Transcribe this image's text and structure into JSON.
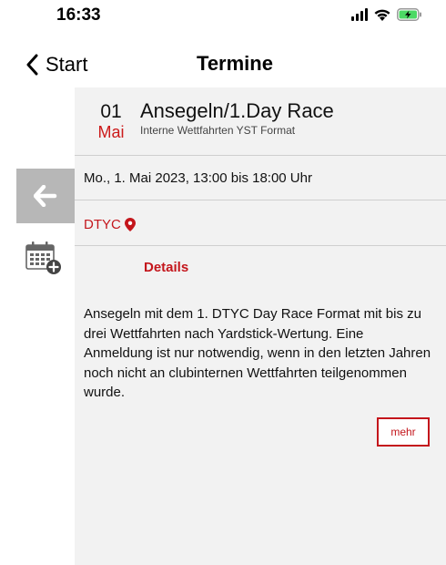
{
  "status_bar": {
    "time": "16:33",
    "icons": [
      "signal-icon",
      "wifi-icon",
      "battery-charging-icon"
    ],
    "battery_color": "#4cd964"
  },
  "nav": {
    "back_label": "Start",
    "title": "Termine"
  },
  "event": {
    "day": "01",
    "month": "Mai",
    "title": "Ansegeln/1.Day Race",
    "subtitle": "Interne Wettfahrten YST Format",
    "datetime": "Mo., 1. Mai 2023, 13:00 bis 18:00 Uhr",
    "location": "DTYC"
  },
  "details": {
    "tab_label": "Details",
    "description": "Ansegeln mit dem 1. DTYC Day Race Format mit bis zu drei Wettfahrten nach Yardstick-Wertung. Eine Anmeldung ist nur notwendig, wenn in den letzten Jahren noch nicht an clubinternen Wettfahrten teilgenommen wurde.",
    "more_label": "mehr"
  },
  "colors": {
    "accent": "#c4161c",
    "content_bg": "#f2f2f2",
    "tile_gray": "#b7b7b7"
  }
}
